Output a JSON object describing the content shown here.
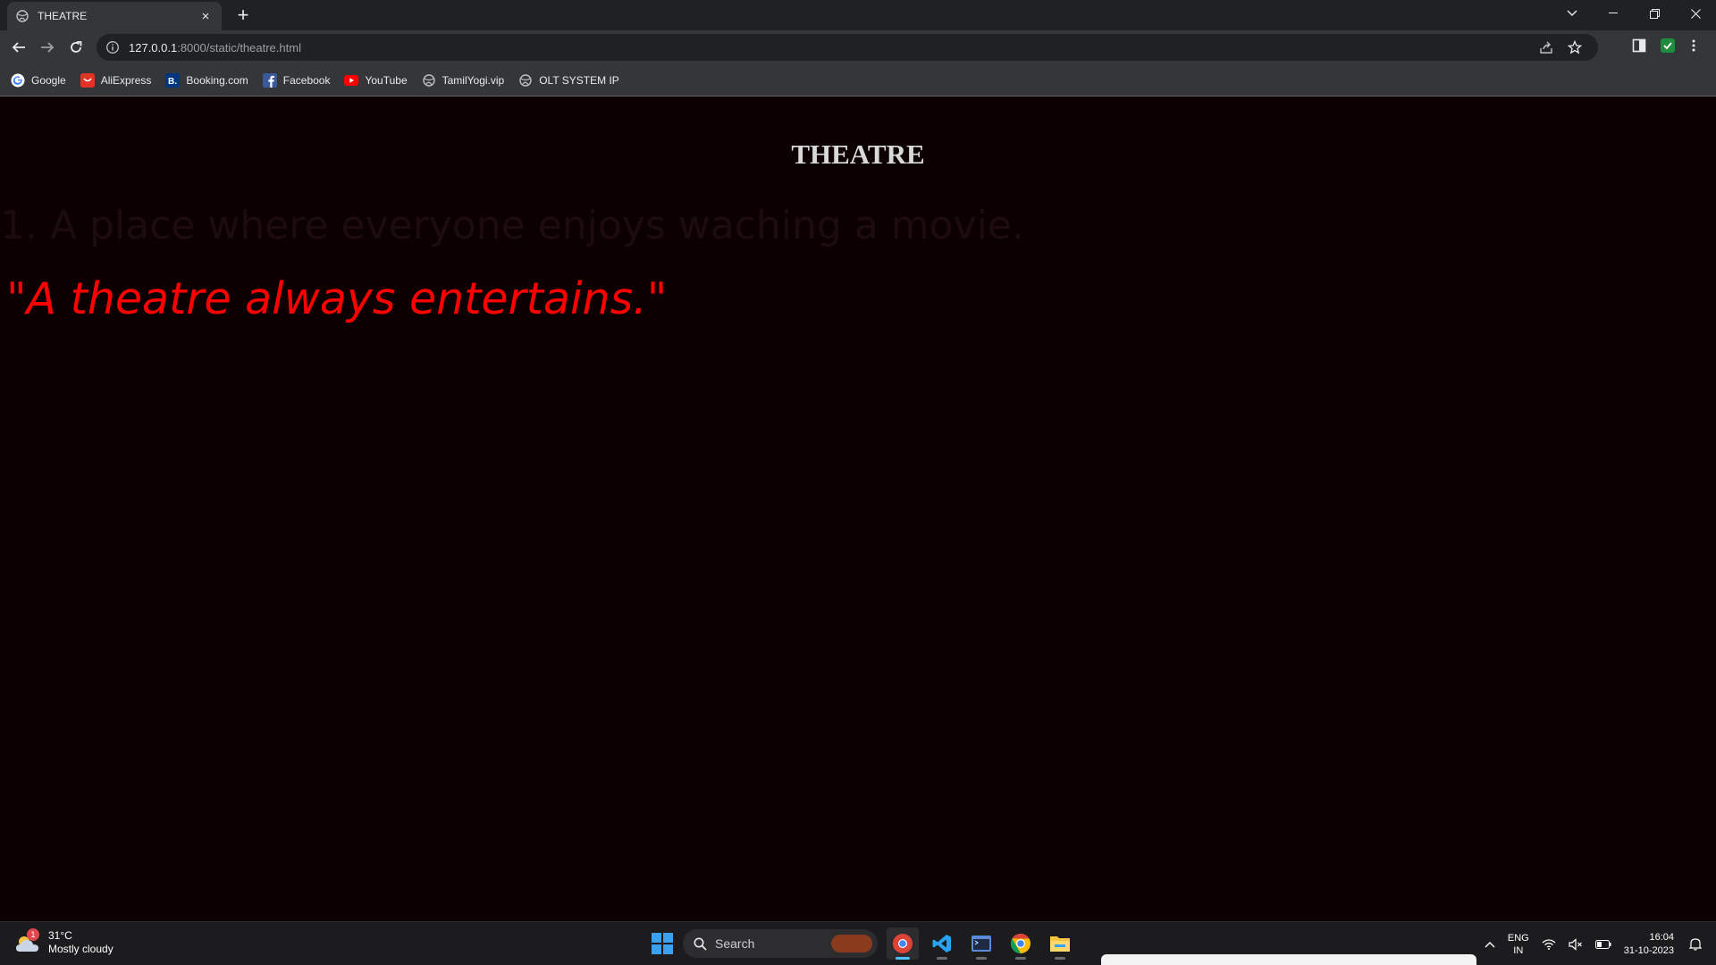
{
  "browser": {
    "tab_title": "THEATRE",
    "tab_close": "×",
    "new_tab": "+",
    "url_host": "127.0.0.1",
    "url_path": ":8000/static/theatre.html"
  },
  "bookmarks": [
    {
      "label": "Google",
      "icon": "google-icon"
    },
    {
      "label": "AliExpress",
      "icon": "aliexpress-icon"
    },
    {
      "label": "Booking.com",
      "icon": "booking-icon"
    },
    {
      "label": "Facebook",
      "icon": "facebook-icon"
    },
    {
      "label": "YouTube",
      "icon": "youtube-icon"
    },
    {
      "label": "TamilYogi.vip",
      "icon": "globe-icon"
    },
    {
      "label": "OLT SYSTEM IP",
      "icon": "globe-icon"
    }
  ],
  "page": {
    "heading": "THEATRE",
    "list_item": "1.  A place where everyone enjoys waching a movie.",
    "quote": "\"A theatre always entertains.\"",
    "background_color": "#0c0002",
    "heading_color": "#d9d9d9",
    "quote_color": "#ff0000"
  },
  "taskbar": {
    "weather_temp": "31°C",
    "weather_desc": "Mostly cloudy",
    "weather_badge": "1",
    "search_label": "Search",
    "lang_line1": "ENG",
    "lang_line2": "IN",
    "time": "16:04",
    "date": "31-10-2023"
  }
}
